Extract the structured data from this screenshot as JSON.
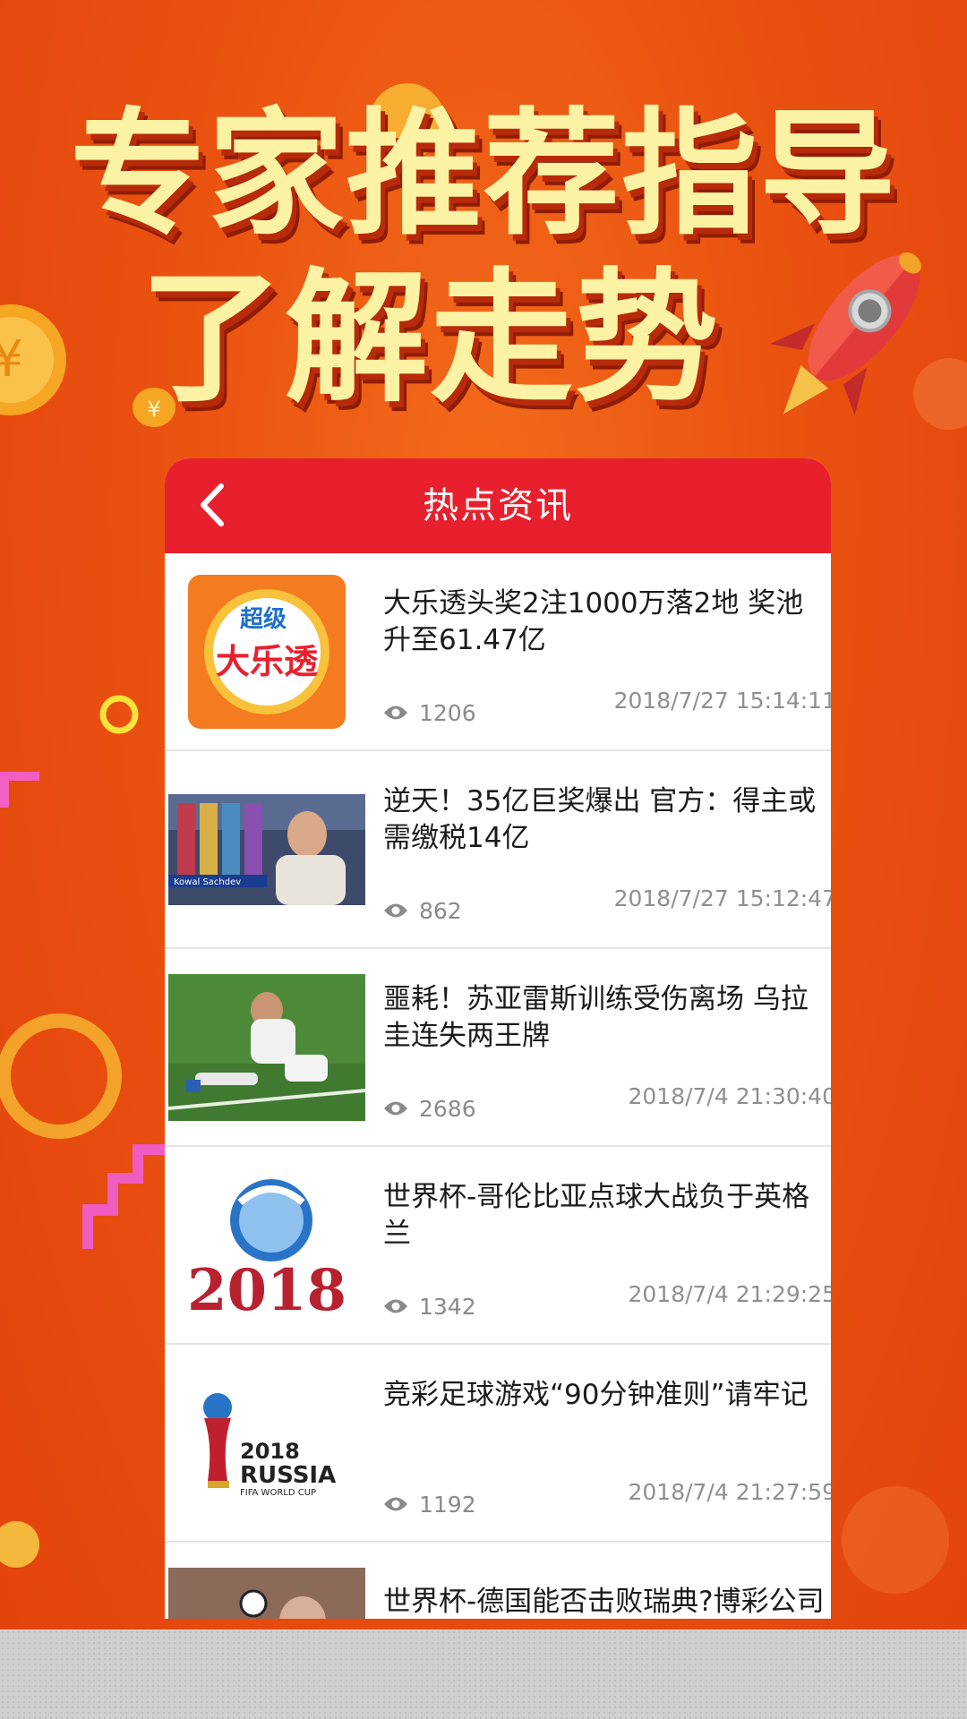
{
  "headline": {
    "line1": "专家推荐指导",
    "line2": "了解走势"
  },
  "colors": {
    "background": "#ea5210",
    "headline_text": "#fbf2a4",
    "appbar": "#e8202e"
  },
  "decorations": [
    "coin-icon",
    "rocket-icon",
    "yen-coin-icon"
  ],
  "appbar": {
    "title": "热点资讯",
    "back_icon": "chevron-left-icon"
  },
  "news": [
    {
      "title": "大乐透头奖2注1000万落2地 奖池升至61.47亿",
      "views": "1206",
      "time": "2018/7/27 15:14:11",
      "thumb_text_1": "超级",
      "thumb_text_2": "大乐透"
    },
    {
      "title": "逆天！35亿巨奖爆出 官方：得主或需缴税14亿",
      "views": "862",
      "time": "2018/7/27 15:12:47",
      "thumb_caption": "Kowal Sachdev"
    },
    {
      "title": "噩耗！苏亚雷斯训练受伤离场 乌拉圭连失两王牌",
      "views": "2686",
      "time": "2018/7/4 21:30:40"
    },
    {
      "title": "世界杯-哥伦比亚点球大战负于英格兰",
      "views": "1342",
      "time": "2018/7/4 21:29:25",
      "thumb_text": "2018"
    },
    {
      "title": "竞彩足球游戏“90分钟准则”请牢记",
      "views": "1192",
      "time": "2018/7/4 21:27:59",
      "thumb_text_1": "2018",
      "thumb_text_2": "RUSSIA",
      "thumb_text_3": "FIFA WORLD CUP"
    },
    {
      "title": "世界杯-德国能否击败瑞典?博彩公司给出答案",
      "views": "",
      "time": ""
    }
  ]
}
